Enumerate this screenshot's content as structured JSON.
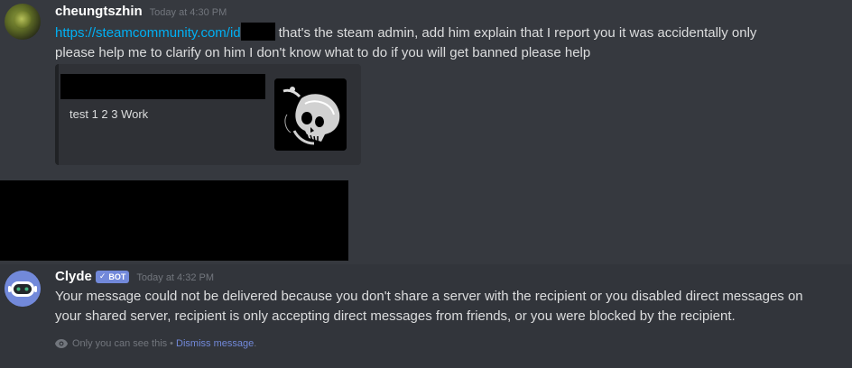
{
  "messages": [
    {
      "username": "cheungtszhin",
      "timestamp": "Today at 4:30 PM",
      "link_text": "https://steamcommunity.com/id",
      "text_after_link": "that's the steam admin, add him explain that I report you it was accidentally only",
      "text_line2": "please help me to clarify on him I don't know what to do if you will get banned please help",
      "embed": {
        "description": "test 1 2 3 Work",
        "thumbnail": "skull-image"
      }
    },
    {
      "username": "Clyde",
      "badge": "BOT",
      "badge_icon": "checkmark-icon",
      "timestamp": "Today at 4:32 PM",
      "text_line1": "Your message could not be delivered because you don't share a server with the recipient or you disabled direct messages on",
      "text_line2": "your shared server, recipient is only accepting direct messages from friends, or you were blocked by the recipient.",
      "ephemeral_icon": "eye-icon",
      "ephemeral_text": "Only you can see this",
      "ephemeral_separator": "•",
      "dismiss_label": "Dismiss message",
      "dismiss_suffix": "."
    }
  ],
  "colors": {
    "background": "#36393f",
    "highlight": "#32353b",
    "link": "#00b0f4",
    "blurple": "#7289da",
    "muted": "#72767d"
  }
}
